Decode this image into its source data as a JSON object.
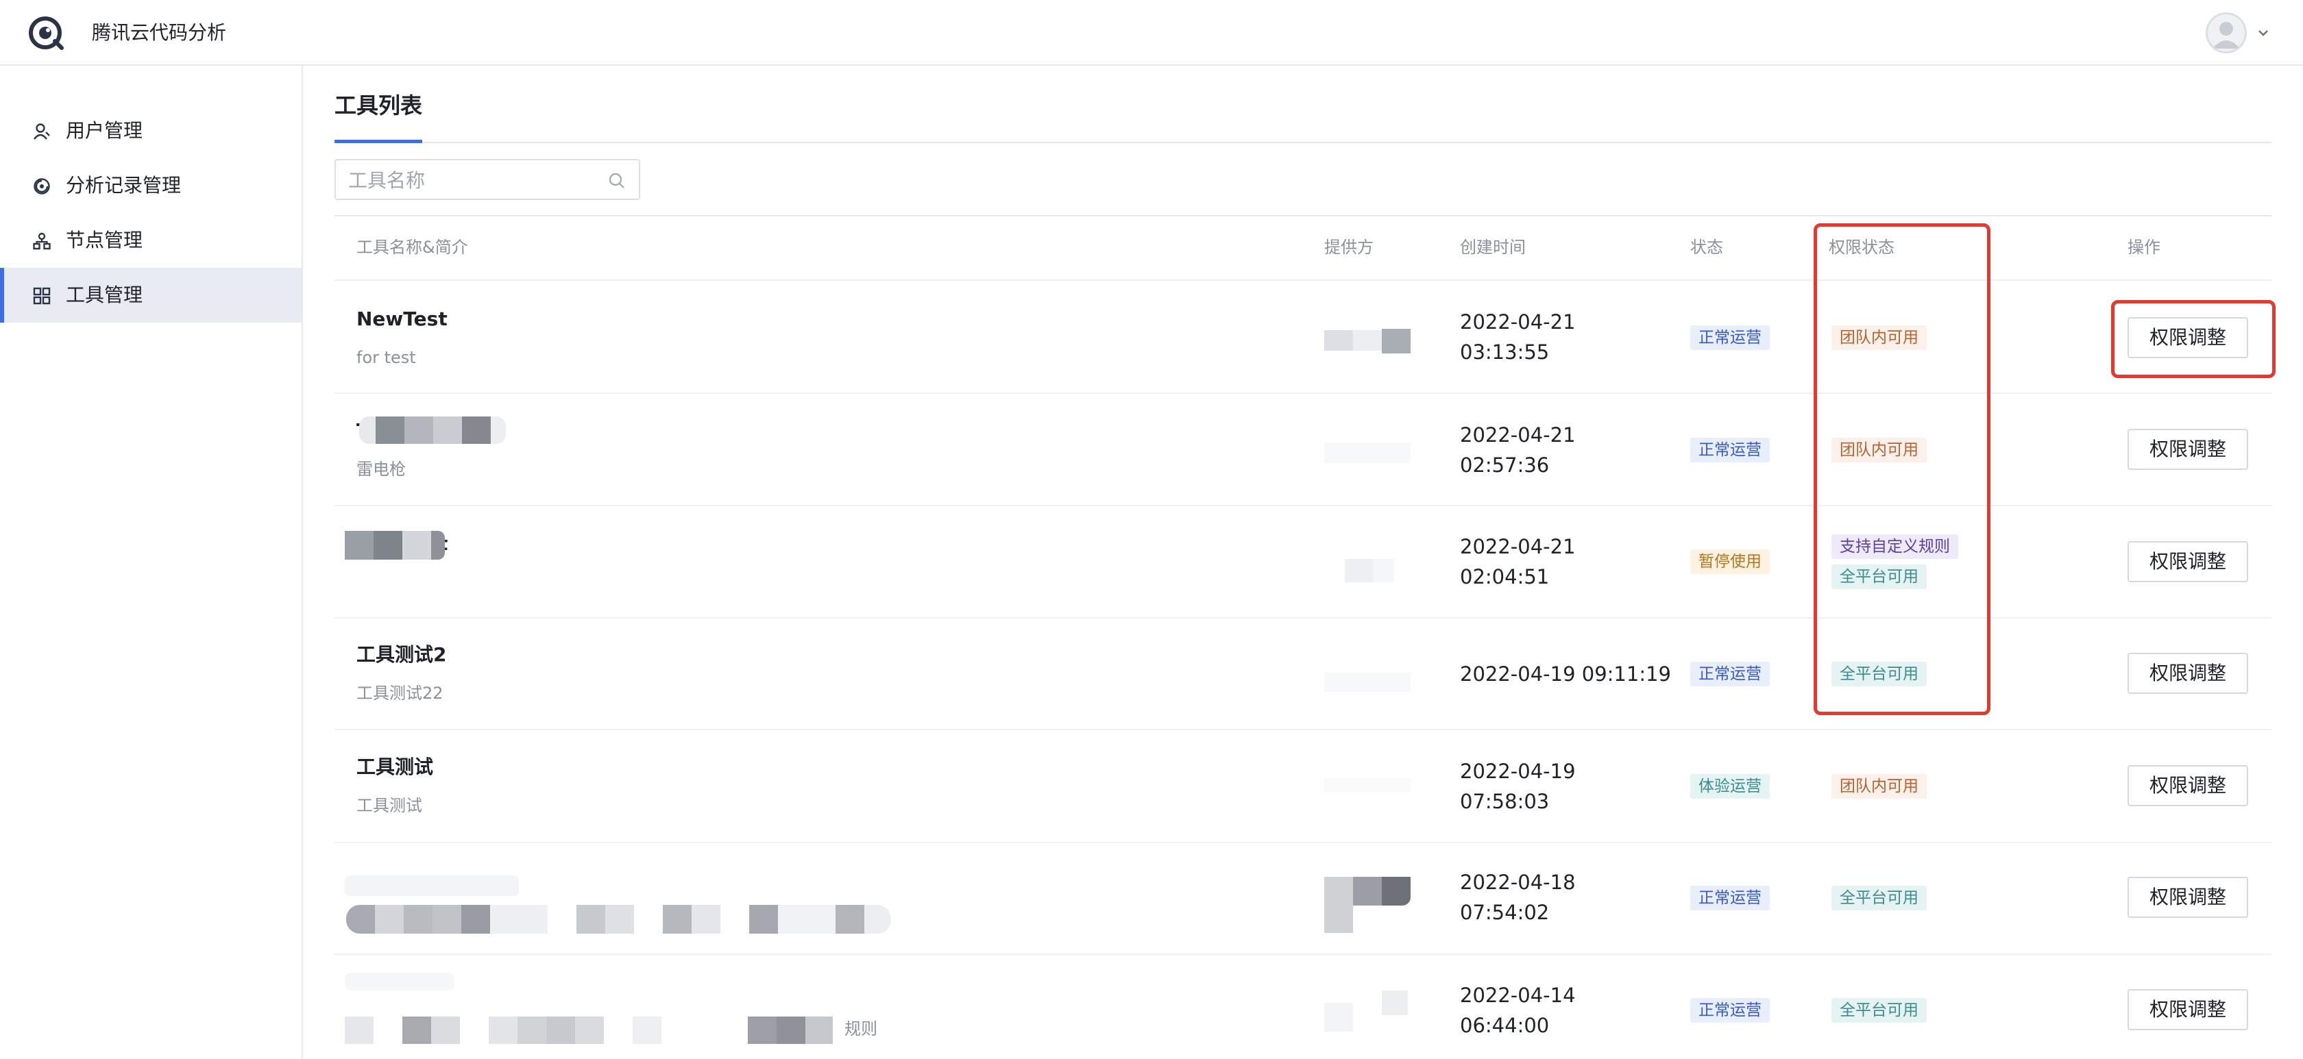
{
  "app": {
    "title": "腾讯云代码分析"
  },
  "sidebar": {
    "items": [
      {
        "label": "用户管理",
        "icon": "user-icon"
      },
      {
        "label": "分析记录管理",
        "icon": "analysis-icon"
      },
      {
        "label": "节点管理",
        "icon": "node-icon"
      },
      {
        "label": "工具管理",
        "icon": "grid-icon",
        "active": true
      }
    ]
  },
  "page": {
    "title": "工具列表"
  },
  "search": {
    "placeholder": "工具名称"
  },
  "table": {
    "headers": [
      "工具名称&简介",
      "提供方",
      "创建时间",
      "状态",
      "权限状态",
      "操作"
    ],
    "rows": [
      {
        "name": "NewTest",
        "desc": "for test",
        "date1": "2022-04-21",
        "date2": "03:13:55",
        "status": "正常运营",
        "perm1": "团队内可用",
        "action": "权限调整"
      },
      {
        "name": "T",
        "desc": "雷电枪",
        "date1": "2022-04-21",
        "date2": "02:57:36",
        "status": "正常运营",
        "perm1": "团队内可用",
        "action": "权限调整"
      },
      {
        "name": "t",
        "desc": "",
        "date1": "2022-04-21",
        "date2": "02:04:51",
        "status": "暂停使用",
        "perm1": "支持自定义规则",
        "perm2": "全平台可用",
        "action": "权限调整"
      },
      {
        "name": "工具测试2",
        "desc": "工具测试22",
        "date1": "2022-04-19 09:11:19",
        "date2": "",
        "status": "正常运营",
        "perm1": "全平台可用",
        "action": "权限调整"
      },
      {
        "name": "工具测试",
        "desc": "工具测试",
        "date1": "2022-04-19",
        "date2": "07:58:03",
        "status": "体验运营",
        "perm1": "团队内可用",
        "action": "权限调整"
      },
      {
        "name": "",
        "desc": "",
        "date1": "2022-04-18",
        "date2": "07:54:02",
        "status": "正常运营",
        "perm1": "全平台可用",
        "action": "权限调整"
      },
      {
        "name": "",
        "desc": "规则",
        "date1": "2022-04-14",
        "date2": "06:44:00",
        "status": "正常运营",
        "perm1": "全平台可用",
        "action": "权限调整"
      }
    ]
  },
  "colors": {
    "accent": "#3d6fe0",
    "highlight_box": "#e23b2e"
  }
}
